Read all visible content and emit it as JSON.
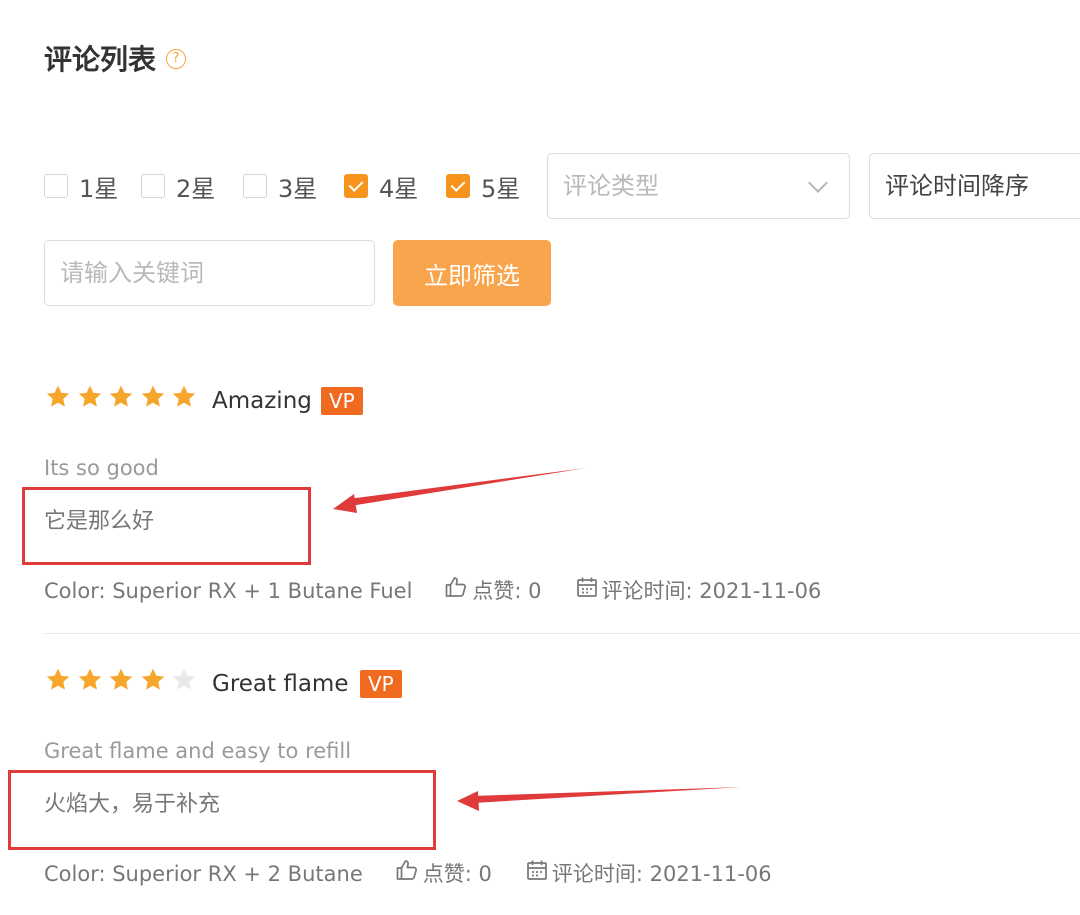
{
  "page": {
    "title": "评论列表",
    "help_icon": "question-circle-icon"
  },
  "filters": {
    "stars": [
      {
        "label": "1星",
        "checked": false
      },
      {
        "label": "2星",
        "checked": false
      },
      {
        "label": "3星",
        "checked": false
      },
      {
        "label": "4星",
        "checked": true
      },
      {
        "label": "5星",
        "checked": true
      }
    ],
    "review_type": {
      "placeholder": "评论类型"
    },
    "sort": {
      "value": "评论时间降序"
    },
    "keyword": {
      "placeholder": "请输入关键词",
      "value": ""
    },
    "submit_label": "立即筛选"
  },
  "reviews": [
    {
      "rating": 5,
      "title": "Amazing",
      "badge": "VP",
      "text_en": "Its so good",
      "text_zh": "它是那么好",
      "color": "Color: Superior RX + 1 Butane Fuel",
      "likes": "点赞: 0",
      "time": "评论时间: 2021-11-06"
    },
    {
      "rating": 4,
      "title": "Great flame",
      "badge": "VP",
      "text_en": "Great flame and easy to refill",
      "text_zh": "火焰大，易于补充",
      "color": "Color: Superior RX + 2 Butane",
      "likes": "点赞: 0",
      "time": "评论时间: 2021-11-06"
    }
  ],
  "colors": {
    "accent": "#f7941d",
    "button": "#f9a54d",
    "star_filled": "#f7a62c",
    "star_empty": "#e9e9e9",
    "badge": "#f06a1f",
    "annotation": "#e03b3b"
  },
  "icons": {
    "like": "thumbs-up-icon",
    "time": "calendar-icon",
    "dropdown": "chevron-down-icon"
  }
}
